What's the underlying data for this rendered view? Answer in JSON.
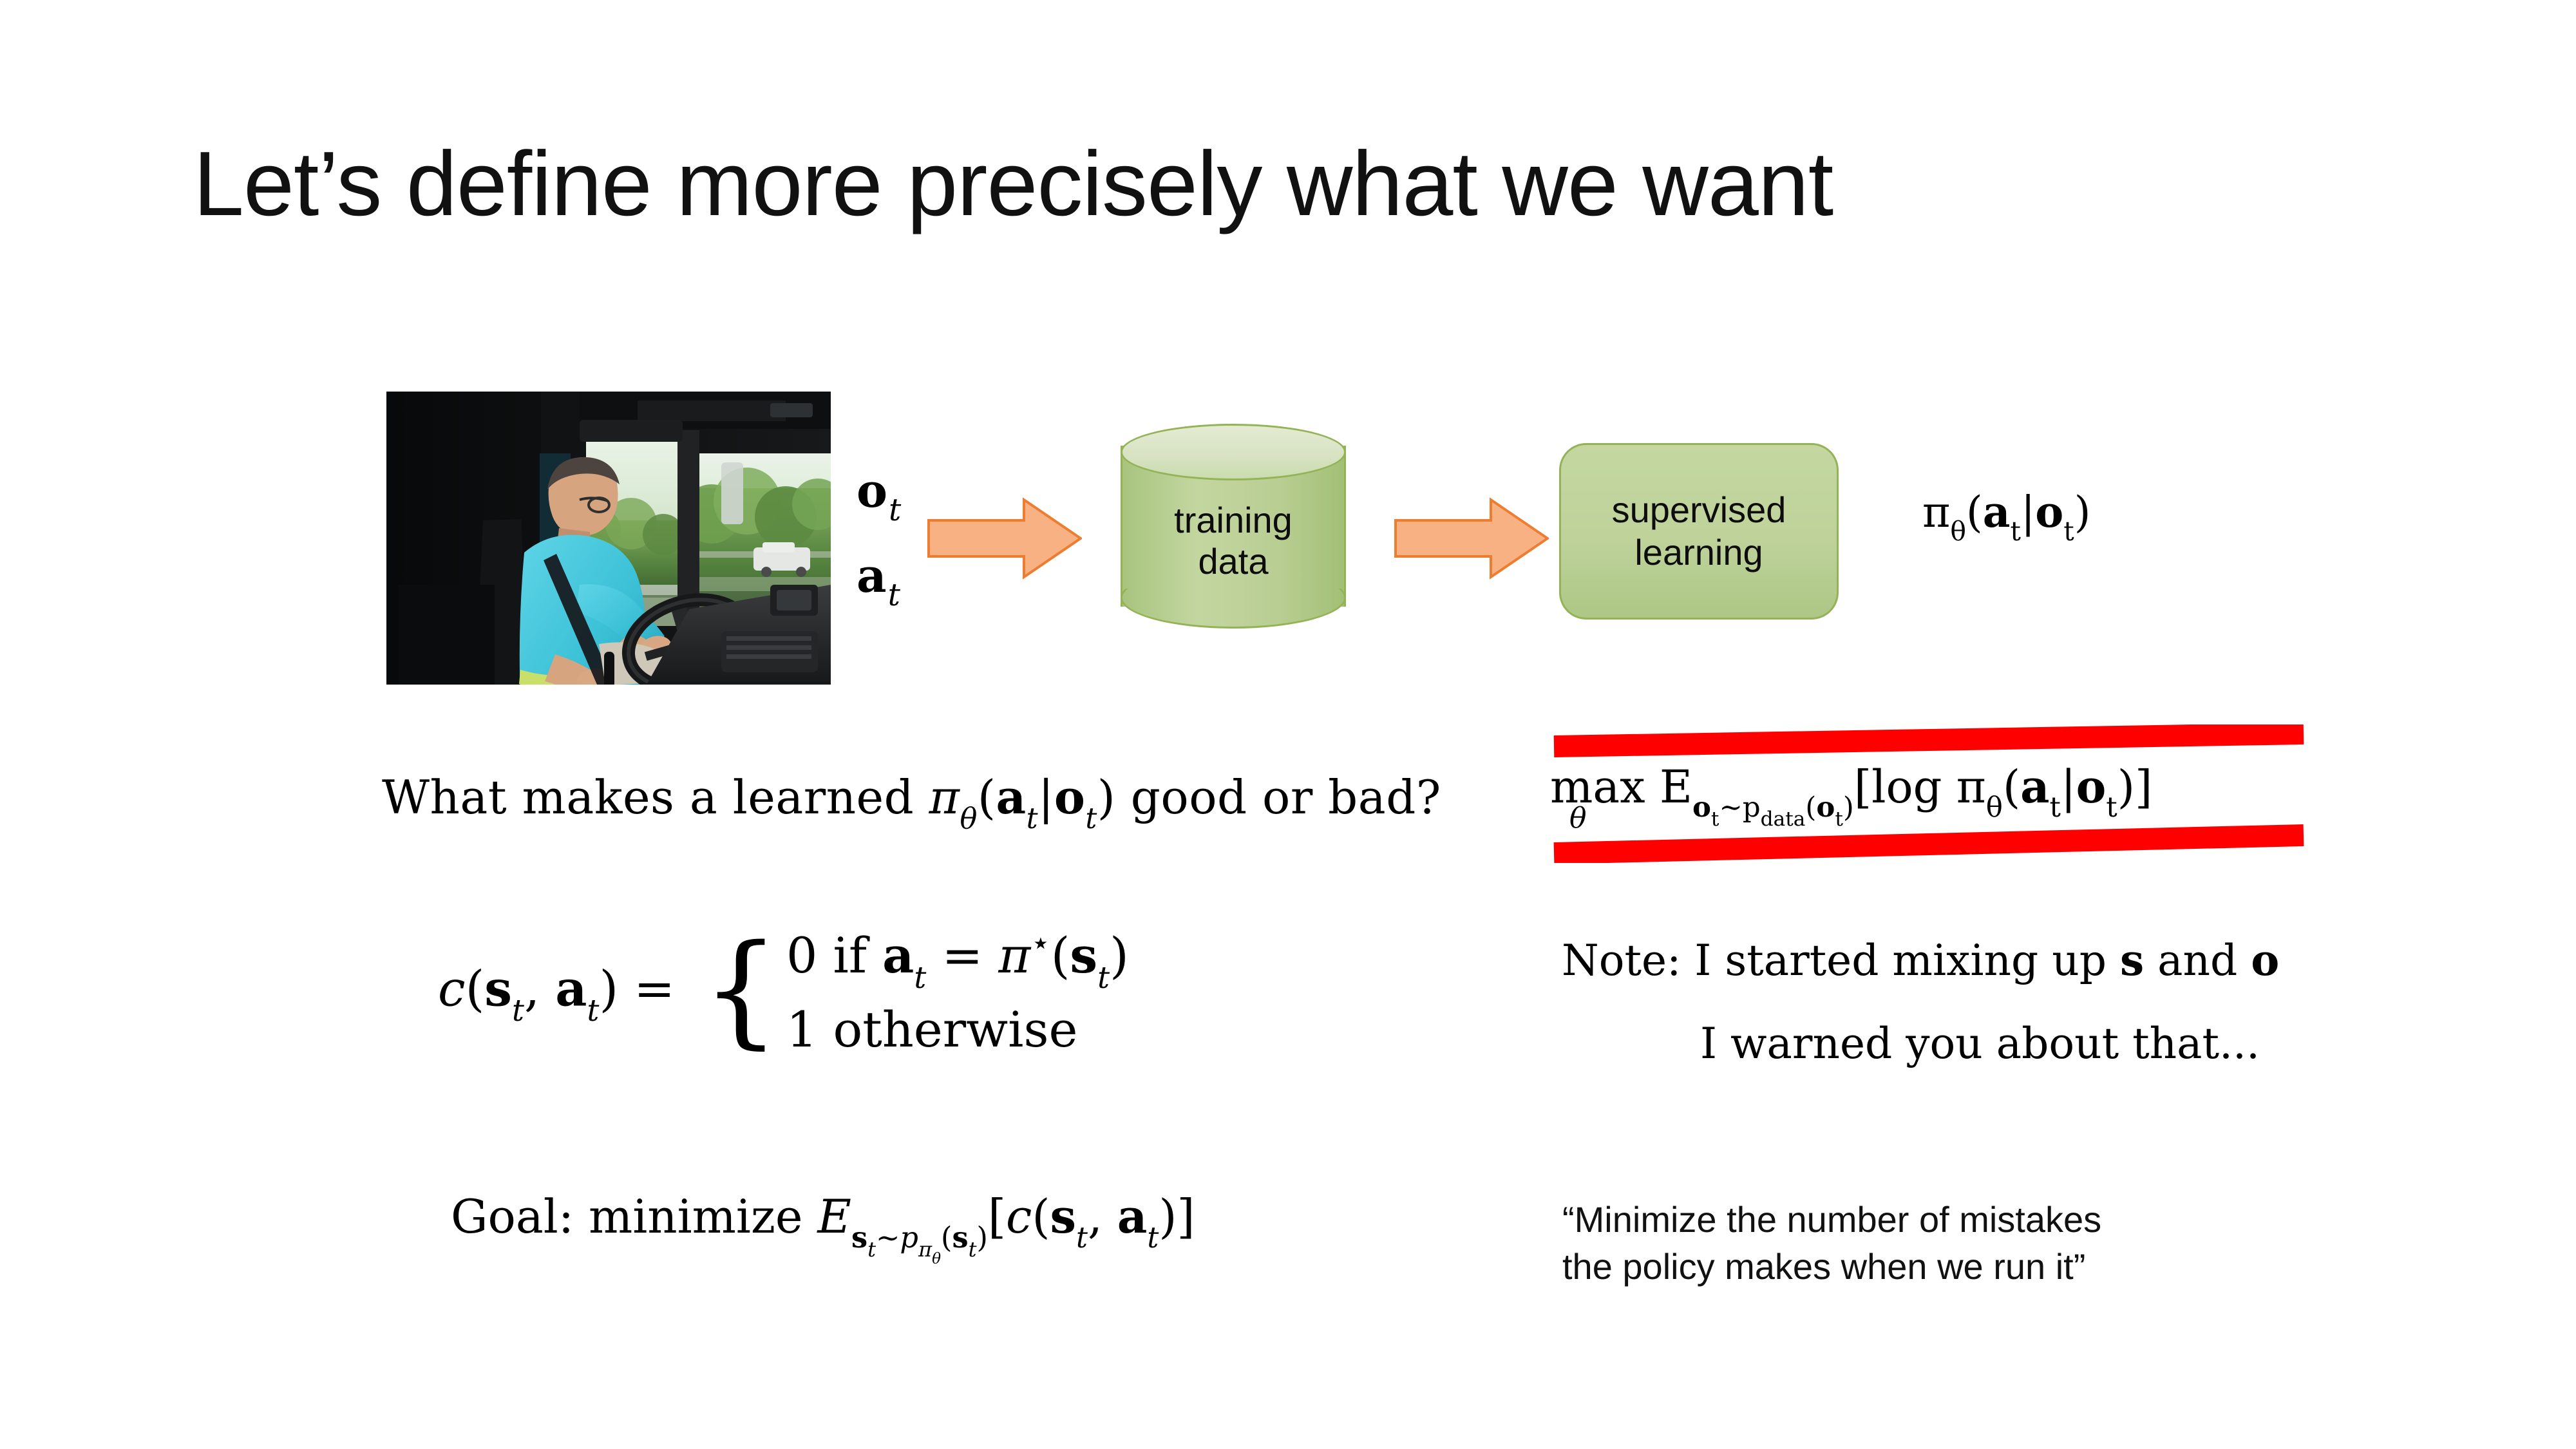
{
  "slide": {
    "title": "Let’s define more precisely what we want",
    "background_color": "#ffffff"
  },
  "colors": {
    "green_fill": "#bdd39b",
    "green_border": "#93b356",
    "green_top_fill": "#dce5c8",
    "orange_fill": "#f8b183",
    "orange_border": "#ed7d31",
    "strikeout_red": "#ff0000",
    "text_black": "#000000"
  },
  "diagram": {
    "photo": {
      "alt_name": "truck-driver-cab-photo",
      "description": "photo of a truck driver in a cyan shirt holding the steering wheel inside a dark cab"
    },
    "input_labels": {
      "observation": "o",
      "observation_subscript": "t",
      "action": "a",
      "action_subscript": "t"
    },
    "arrow_1_name": "orange-right-arrow",
    "arrow_2_name": "orange-right-arrow",
    "training_data": {
      "line1": "training",
      "line2": "data"
    },
    "supervised_learning": {
      "line1": "supervised",
      "line2": "learning"
    },
    "policy_notation": {
      "pi": "π",
      "theta": "θ",
      "open": "(",
      "action": "a",
      "action_sub": "t",
      "bar": "|",
      "observation": "o",
      "observation_sub": "t",
      "close": ")"
    }
  },
  "body": {
    "question": {
      "prefix": "What makes a learned ",
      "pi": "π",
      "theta": "θ",
      "policy_args": "(a t|o t)",
      "suffix": " good or bad?"
    },
    "crossed_equation": {
      "max": "max",
      "max_subscript": "θ",
      "expectation": "E",
      "expectation_subscript": "o t ∼ p data(o t)",
      "bracket_open": "[",
      "log": "log ",
      "pi": "π",
      "theta": "θ",
      "policy_args": "(a t|o t)",
      "bracket_close": "]",
      "struck_out": true
    },
    "cost_function": {
      "lhs": "c(s t, a t)",
      "equals": "=",
      "case_1": "0 if a t = π⋆(s t)",
      "case_2": "1 otherwise"
    },
    "note": {
      "line1_prefix": "Note:  I started mixing up ",
      "line1_s": "s",
      "line1_mid": " and ",
      "line1_o": "o",
      "line2": "I warned you about that..."
    },
    "goal": {
      "prefix": "Goal:  minimize ",
      "expectation": "E",
      "expectation_subscript": "s t ∼ p πθ(s t)",
      "bracket": "[c(s t, a t)]"
    },
    "quote": {
      "line1": "“Minimize the number of mistakes",
      "line2": "the policy makes when we run it”"
    }
  }
}
